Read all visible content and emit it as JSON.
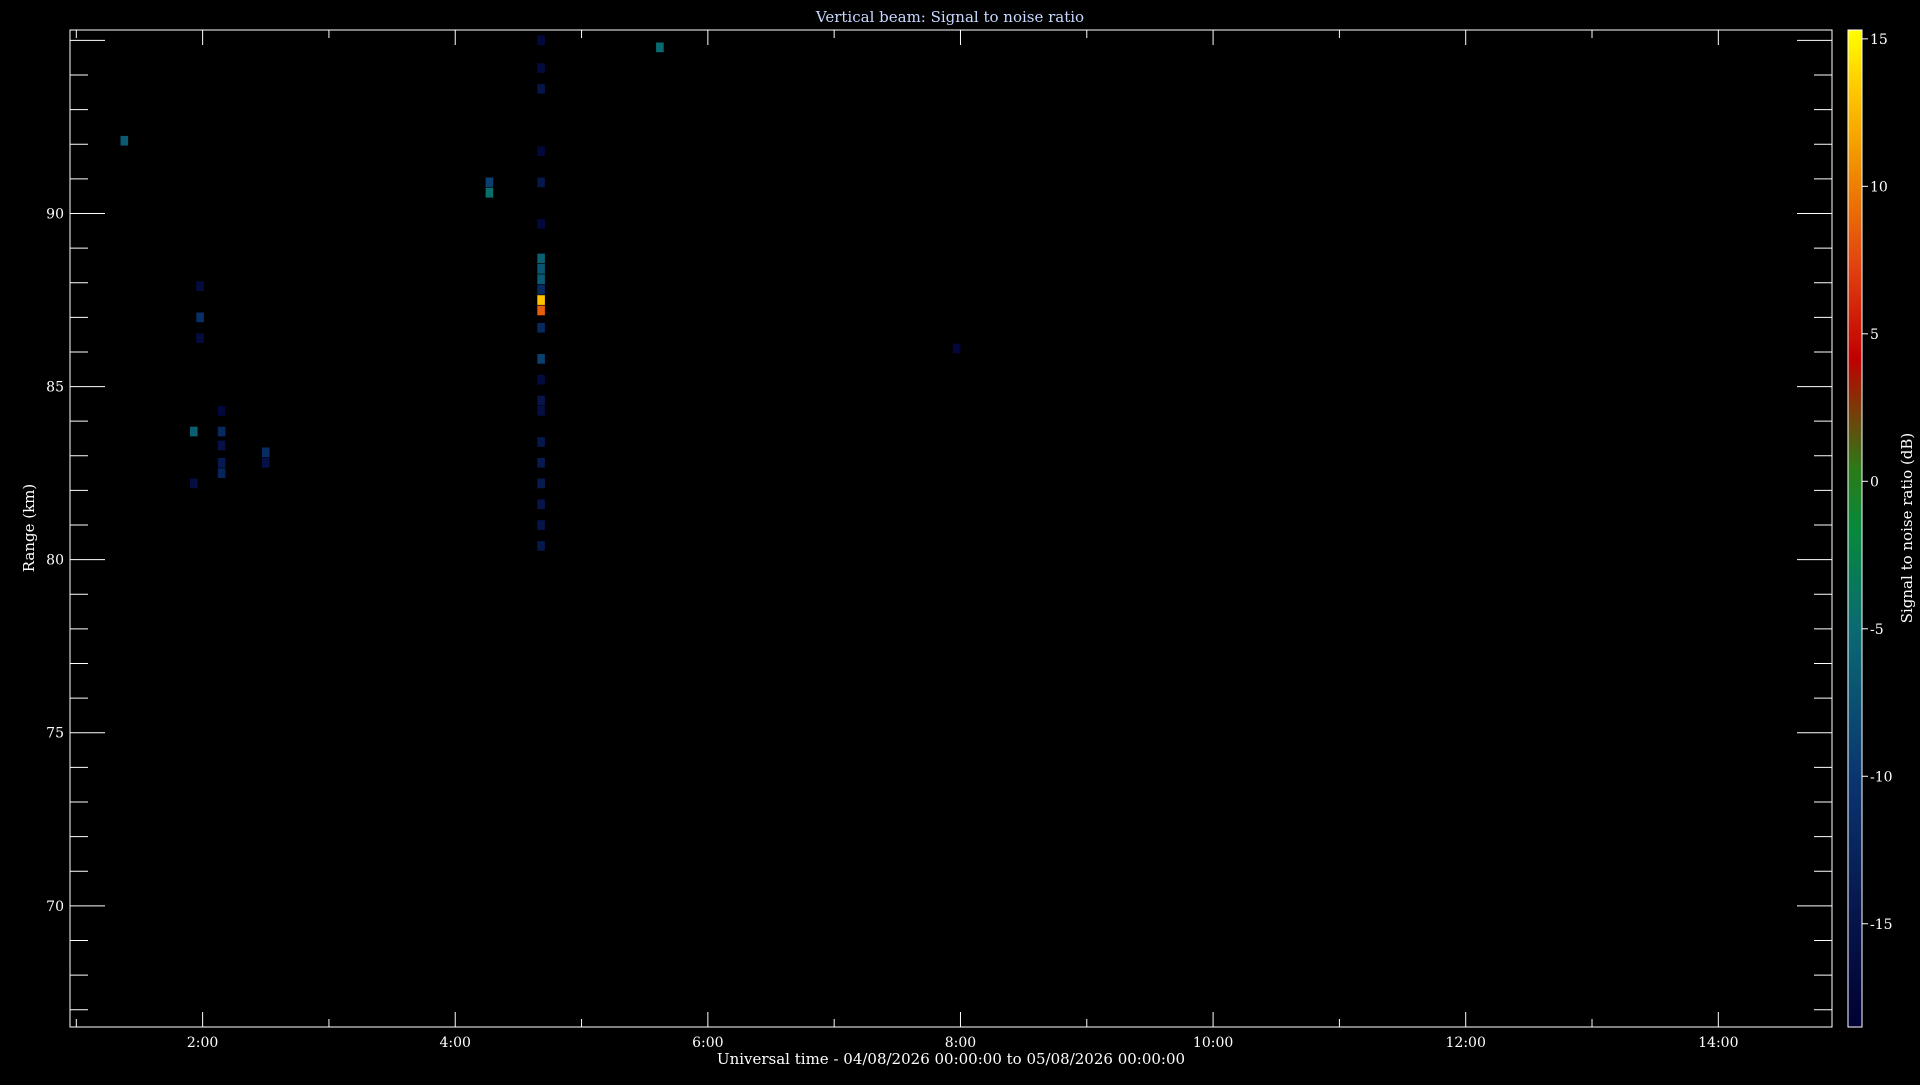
{
  "chart_data": {
    "type": "heatmap",
    "title": "Vertical beam: Signal to noise ratio",
    "xlabel": "Universal time - 04/08/2026 00:00:00 to 05/08/2026 00:00:00",
    "ylabel": "Range (km)",
    "colorbar_label": "Signal to noise ratio (dB)",
    "xlim": [
      0.95,
      14.9
    ],
    "ylim": [
      66.5,
      95.3
    ],
    "clim": [
      -18.5,
      15.3
    ],
    "x_ticks": [
      {
        "value": 2,
        "label": "2:00"
      },
      {
        "value": 4,
        "label": "4:00"
      },
      {
        "value": 6,
        "label": "6:00"
      },
      {
        "value": 8,
        "label": "8:00"
      },
      {
        "value": 10,
        "label": "10:00"
      },
      {
        "value": 12,
        "label": "12:00"
      },
      {
        "value": 14,
        "label": "14:00"
      }
    ],
    "y_ticks": [
      {
        "value": 70,
        "label": "70"
      },
      {
        "value": 75,
        "label": "75"
      },
      {
        "value": 80,
        "label": "80"
      },
      {
        "value": 85,
        "label": "85"
      },
      {
        "value": 90,
        "label": "90"
      }
    ],
    "colorbar_ticks": [
      {
        "value": -15,
        "label": "-15"
      },
      {
        "value": -10,
        "label": "-10"
      },
      {
        "value": -5,
        "label": "-5"
      },
      {
        "value": 0,
        "label": "0"
      },
      {
        "value": 5,
        "label": "5"
      },
      {
        "value": 10,
        "label": "10"
      },
      {
        "value": 15,
        "label": "15"
      }
    ],
    "cells": [
      {
        "t": 1.38,
        "range": 92.1,
        "snr": -6.5
      },
      {
        "t": 1.93,
        "range": 83.7,
        "snr": -6
      },
      {
        "t": 1.93,
        "range": 82.2,
        "snr": -16
      },
      {
        "t": 1.98,
        "range": 87.0,
        "snr": -11
      },
      {
        "t": 1.98,
        "range": 87.9,
        "snr": -16.5
      },
      {
        "t": 1.98,
        "range": 86.4,
        "snr": -16.5
      },
      {
        "t": 2.15,
        "range": 83.7,
        "snr": -12
      },
      {
        "t": 2.15,
        "range": 83.3,
        "snr": -15.5
      },
      {
        "t": 2.15,
        "range": 82.8,
        "snr": -14
      },
      {
        "t": 2.15,
        "range": 82.5,
        "snr": -12.5
      },
      {
        "t": 2.15,
        "range": 84.3,
        "snr": -17
      },
      {
        "t": 2.5,
        "range": 83.1,
        "snr": -11.5
      },
      {
        "t": 2.5,
        "range": 82.8,
        "snr": -15.5
      },
      {
        "t": 4.27,
        "range": 90.9,
        "snr": -9
      },
      {
        "t": 4.27,
        "range": 90.6,
        "snr": -4.5
      },
      {
        "t": 4.68,
        "range": 88.7,
        "snr": -6
      },
      {
        "t": 4.68,
        "range": 88.4,
        "snr": -7
      },
      {
        "t": 4.68,
        "range": 88.1,
        "snr": -6.5
      },
      {
        "t": 4.68,
        "range": 87.8,
        "snr": -12
      },
      {
        "t": 4.68,
        "range": 87.5,
        "snr": 13
      },
      {
        "t": 4.68,
        "range": 87.2,
        "snr": 8.5
      },
      {
        "t": 4.68,
        "range": 86.7,
        "snr": -12
      },
      {
        "t": 4.68,
        "range": 85.8,
        "snr": -9
      },
      {
        "t": 4.68,
        "range": 85.2,
        "snr": -16.5
      },
      {
        "t": 4.68,
        "range": 84.6,
        "snr": -15
      },
      {
        "t": 4.68,
        "range": 84.3,
        "snr": -16
      },
      {
        "t": 4.68,
        "range": 83.4,
        "snr": -14.5
      },
      {
        "t": 4.68,
        "range": 82.8,
        "snr": -14
      },
      {
        "t": 4.68,
        "range": 82.2,
        "snr": -14
      },
      {
        "t": 4.68,
        "range": 81.6,
        "snr": -15
      },
      {
        "t": 4.68,
        "range": 81.0,
        "snr": -15
      },
      {
        "t": 4.68,
        "range": 80.4,
        "snr": -14.5
      },
      {
        "t": 4.68,
        "range": 90.9,
        "snr": -14.5
      },
      {
        "t": 4.68,
        "range": 91.8,
        "snr": -17
      },
      {
        "t": 4.68,
        "range": 93.6,
        "snr": -15
      },
      {
        "t": 4.68,
        "range": 94.2,
        "snr": -16.5
      },
      {
        "t": 4.68,
        "range": 95.0,
        "snr": -17
      },
      {
        "t": 4.68,
        "range": 89.7,
        "snr": -17
      },
      {
        "t": 5.62,
        "range": 94.8,
        "snr": -5
      },
      {
        "t": 7.97,
        "range": 86.1,
        "snr": -17.5
      }
    ]
  }
}
